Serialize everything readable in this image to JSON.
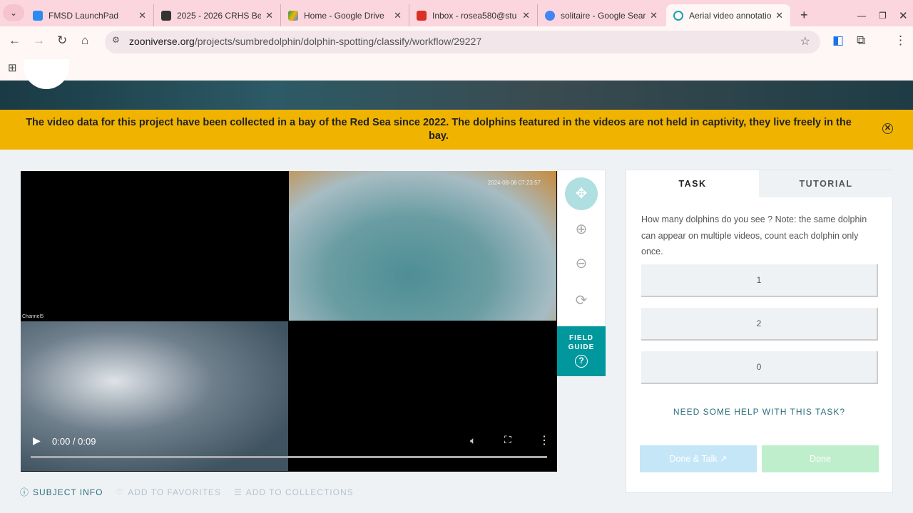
{
  "browser": {
    "tabs": [
      {
        "label": "FMSD LaunchPad",
        "color": "#2a8cf0"
      },
      {
        "label": "2025 - 2026 CRHS Bet",
        "color": "#333"
      },
      {
        "label": "Home - Google Drive",
        "color": "#f4b400"
      },
      {
        "label": "Inbox - rosea580@stu",
        "color": "#d93025"
      },
      {
        "label": "solitaire - Google Sear",
        "color": "#4285f4"
      },
      {
        "label": "Aerial video annotatio",
        "color": "#1aa0b5"
      }
    ],
    "url_domain": "zooniverse.org",
    "url_path": "/projects/sumbredolphin/dolphin-spotting/classify/workflow/29227"
  },
  "banner": {
    "text": "The video data for this project have been collected in a bay of the Red Sea since 2022. The dolphins featured in the videos are not held in captivity, they live freely in the bay."
  },
  "video": {
    "channel_label": "Channel5",
    "timestamp": "2024-08-08 07:23:57",
    "time": "0:00 / 0:09",
    "progress": 0
  },
  "field_guide": {
    "label": "FIELD GUIDE"
  },
  "task": {
    "tabs": [
      "TASK",
      "TUTORIAL"
    ],
    "question": "How many dolphins do you see ? Note: the same dolphin can appear on multiple videos, count each dolphin only once.",
    "answers": [
      "1",
      "2",
      "0"
    ],
    "help": "NEED SOME HELP WITH THIS TASK?",
    "done_talk": "Done & Talk",
    "done": "Done"
  },
  "footer_links": [
    "SUBJECT INFO",
    "ADD TO FAVORITES",
    "ADD TO COLLECTIONS"
  ]
}
